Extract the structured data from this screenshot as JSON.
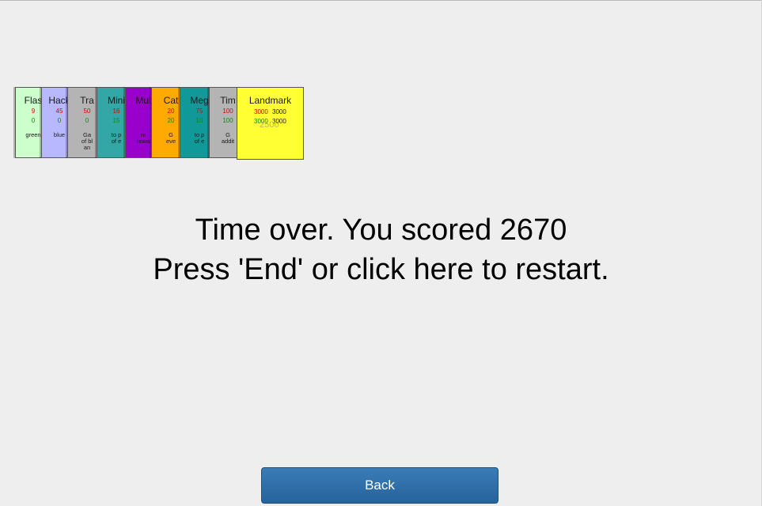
{
  "cards": [
    {
      "title": "Flas",
      "cost": "9",
      "value": "0",
      "desc": "green",
      "color": "#ccffcc"
    },
    {
      "title": "Hack",
      "cost": "45",
      "value": "0",
      "desc": "blue",
      "color": "#b8b8ff"
    },
    {
      "title": "Tra",
      "cost": "50",
      "value": "0",
      "desc": "Ga\nof bl\nan",
      "color": "#b4b4b4"
    },
    {
      "title": "Mini",
      "cost": "16",
      "value": "15",
      "desc": "to p\nof e",
      "color": "#33a6a6"
    },
    {
      "title": "Mul",
      "cost": "",
      "value": "",
      "desc": "re\nrewa",
      "color": "#9900cc"
    },
    {
      "title": "Cat",
      "cost": "20",
      "value": "20",
      "desc": "G\neve",
      "color": "#ffaa00"
    },
    {
      "title": "Meg",
      "cost": "75",
      "value": "10",
      "desc": "to p\nof e",
      "color": "#119999"
    },
    {
      "title": "Tim",
      "cost": "100",
      "value": "100",
      "desc": "G\naddit",
      "color": "#b4b4b4"
    }
  ],
  "landmark": {
    "title": "Landmark",
    "cost_a": "3000",
    "cost_b": "3000",
    "value_a": "3000",
    "value_b": "3000",
    "ghost": "2500",
    "color": "#ffff33"
  },
  "message": {
    "line1": "Time over. You scored 2670",
    "line2": "Press 'End' or click here to restart."
  },
  "back_button": {
    "label": "Back"
  }
}
